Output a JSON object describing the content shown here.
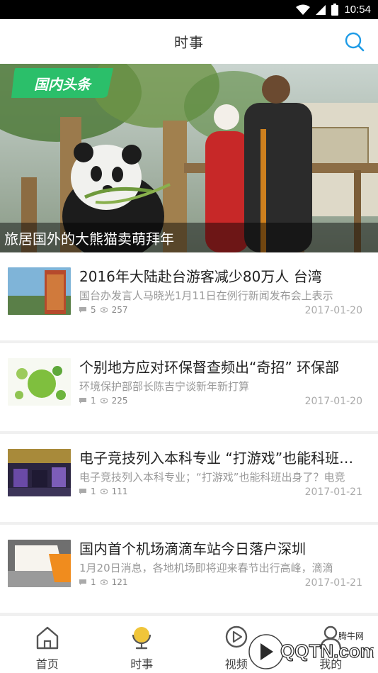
{
  "status_bar": {
    "time": "10:54"
  },
  "header": {
    "title": "时事"
  },
  "hero": {
    "badge": "国内头条",
    "caption": "旅居国外的大熊猫卖萌拜年"
  },
  "news": [
    {
      "title": " 2016年大陆赴台游客减少80万人 台湾",
      "desc": "国台办发言人马晓光1月11日在例行新闻发布会上表示",
      "comments": "5",
      "views": "257",
      "date": "2017-01-20"
    },
    {
      "title": "个别地方应对环保督查频出“奇招” 环保部",
      "desc": "环境保护部部长陈吉宁谈新年新打算",
      "comments": "1",
      "views": "225",
      "date": "2017-01-20"
    },
    {
      "title": "电子竞技列入本科专业 “打游戏”也能科班出身",
      "desc": "电子竞技列入本科专业；“打游戏”也能科班出身了？电竞",
      "comments": "1",
      "views": "111",
      "date": "2017-01-21"
    },
    {
      "title": "国内首个机场滴滴车站今日落户深圳",
      "desc": "1月20日消息，各地机场即将迎来春节出行高峰，滴滴",
      "comments": "1",
      "views": "121",
      "date": "2017-01-21"
    }
  ],
  "tabs": [
    {
      "label": "首页",
      "icon": "home-icon"
    },
    {
      "label": "时事",
      "icon": "globe-icon"
    },
    {
      "label": "视频",
      "icon": "play-icon"
    },
    {
      "label": "我的",
      "icon": "user-icon"
    }
  ],
  "colors": {
    "accent": "#1e9be6",
    "badge_green": "#2bbf6a",
    "tab_active": "#e8b92a"
  },
  "watermark": {
    "text": "QQTN.com",
    "sub": "腾牛网"
  }
}
